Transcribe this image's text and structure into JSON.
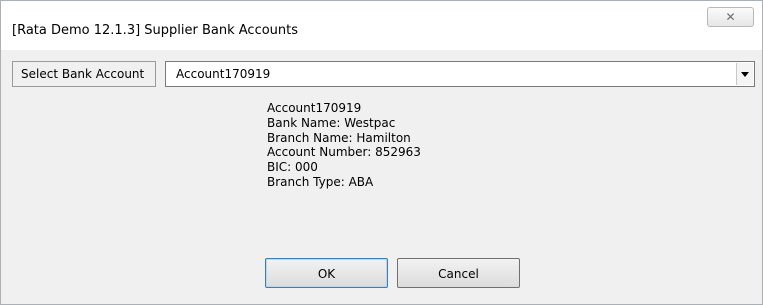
{
  "window": {
    "title": "[Rata Demo 12.1.3] Supplier Bank Accounts",
    "close_glyph": "✕",
    "close_icon": "close-icon"
  },
  "selector": {
    "label": "Select Bank Account",
    "selected_value": "Account170919",
    "arrow_icon": "chevron-down-icon"
  },
  "account_details": {
    "account_name": "Account170919",
    "bank_name": "Bank Name:  Westpac",
    "branch_name": "Branch Name: Hamilton",
    "account_number": "Account Number: 852963",
    "bic": "BIC: 000",
    "branch_type": "Branch Type: ABA"
  },
  "buttons": {
    "ok_label": "OK",
    "cancel_label": "Cancel"
  },
  "colors": {
    "dialog_background": "#f0f0f0",
    "titlebar_background": "#ffffff",
    "default_button_border": "#3c7fb1"
  }
}
